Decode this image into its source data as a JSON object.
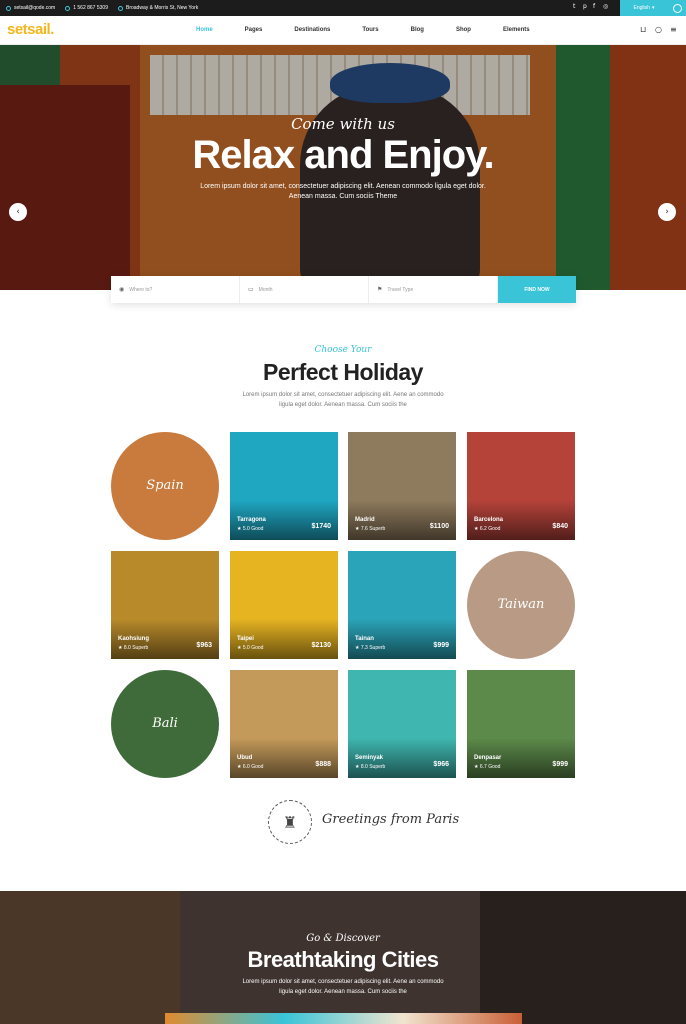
{
  "topbar": {
    "email": "setsail@qode.com",
    "phone": "1 562 867 5309",
    "address": "Broadway & Morris St, New York",
    "social_icons": [
      "twitter-icon",
      "pinterest-icon",
      "facebook-icon",
      "instagram-icon"
    ],
    "language": "English"
  },
  "nav": {
    "logo": "setsail.",
    "items": [
      "Home",
      "Pages",
      "Destinations",
      "Tours",
      "Blog",
      "Shop",
      "Elements"
    ],
    "active": "Home"
  },
  "hero": {
    "script": "Come with us",
    "title": "Relax and Enjoy.",
    "text": "Lorem ipsum dolor sit amet, consectetuer adipiscing elit. Aenean commodo ligula eget dolor. Aenean massa. Cum sociis Theme"
  },
  "search": {
    "where_placeholder": "Where to?",
    "month_placeholder": "Month",
    "type_placeholder": "Travel Type",
    "button": "FIND NOW"
  },
  "holiday": {
    "script": "Choose Your",
    "title": "Perfect Holiday",
    "text": "Lorem ipsum dolor sit amet, consectetuer adipiscing elit. Aene an commodo ligula eget dolor. Aenean massa. Cum sociis the"
  },
  "destinations": [
    {
      "name": "Spain",
      "round": true,
      "color": "#c97a3d"
    },
    {
      "name": "Tarragona",
      "rating": "5.0 Good",
      "price": "$1740",
      "color": "#1fa7c2"
    },
    {
      "name": "Madrid",
      "rating": "7.6 Superb",
      "price": "$1100",
      "color": "#8e7a5c"
    },
    {
      "name": "Barcelona",
      "rating": "6.2 Good",
      "price": "$840",
      "color": "#b5433a"
    },
    {
      "name": "Kaohsiung",
      "rating": "8.0 Superb",
      "price": "$963",
      "color": "#b88a2a"
    },
    {
      "name": "Taipei",
      "rating": "5.0 Good",
      "price": "$2130",
      "color": "#e6b321"
    },
    {
      "name": "Tainan",
      "rating": "7.3 Superb",
      "price": "$999",
      "color": "#2aa4b8"
    },
    {
      "name": "Taiwan",
      "round": true,
      "color": "#b99b85"
    },
    {
      "name": "Bali",
      "round": true,
      "color": "#3f6b3a"
    },
    {
      "name": "Ubud",
      "rating": "6.0 Good",
      "price": "$888",
      "color": "#c49a5a"
    },
    {
      "name": "Seminyak",
      "rating": "8.0 Superb",
      "price": "$966",
      "color": "#3fb6b0"
    },
    {
      "name": "Denpasar",
      "rating": "6.7 Good",
      "price": "$999",
      "color": "#5c8a4a"
    }
  ],
  "greeting": {
    "text": "Greetings from Paris"
  },
  "cities": {
    "script": "Go & Discover",
    "title": "Breathtaking Cities",
    "text": "Lorem ipsum dolor sit amet, consectetuer adipiscing elit. Aene an commodo ligula eget dolor. Aenean massa. Cum sociis the"
  }
}
